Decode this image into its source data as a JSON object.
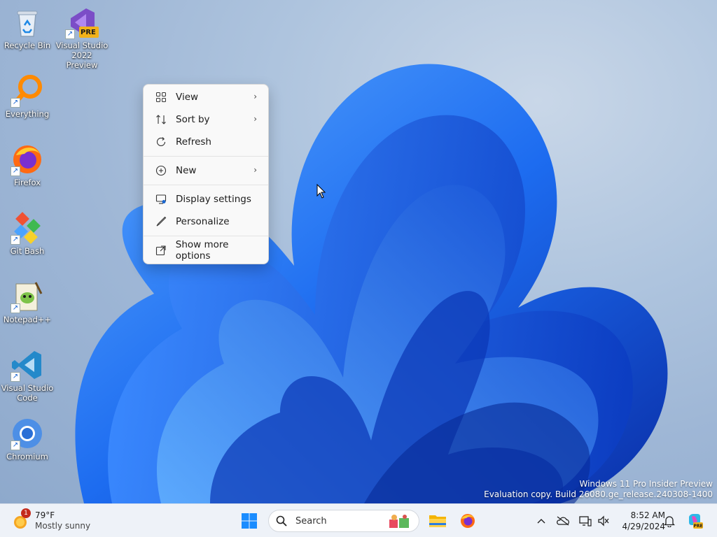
{
  "desktop": {
    "icons": [
      {
        "label": "Recycle Bin",
        "icon": "recycle-bin-icon"
      },
      {
        "label": "Visual Studio 2022 Preview",
        "icon": "visual-studio-preview-icon",
        "badge": "PRE"
      },
      {
        "label": "Everything",
        "icon": "everything-search-icon"
      },
      {
        "label": "Firefox",
        "icon": "firefox-icon"
      },
      {
        "label": "Git Bash",
        "icon": "git-bash-icon"
      },
      {
        "label": "Notepad++",
        "icon": "notepad-plus-plus-icon"
      },
      {
        "label": "Visual Studio Code",
        "icon": "vscode-icon"
      },
      {
        "label": "Chromium",
        "icon": "chromium-icon"
      }
    ]
  },
  "context_menu": {
    "items": [
      {
        "label": "View",
        "icon": "view-grid-icon",
        "has_submenu": true
      },
      {
        "label": "Sort by",
        "icon": "sort-icon",
        "has_submenu": true
      },
      {
        "label": "Refresh",
        "icon": "refresh-icon",
        "has_submenu": false
      },
      {
        "label": "New",
        "icon": "new-plus-icon",
        "has_submenu": true
      },
      {
        "label": "Display settings",
        "icon": "display-settings-icon",
        "has_submenu": false
      },
      {
        "label": "Personalize",
        "icon": "personalize-brush-icon",
        "has_submenu": false
      },
      {
        "label": "Show more options",
        "icon": "show-more-options-icon",
        "has_submenu": false
      }
    ]
  },
  "watermark": {
    "line1": "Windows 11 Pro Insider Preview",
    "line2": "Evaluation copy. Build 26080.ge_release.240308-1400"
  },
  "taskbar": {
    "weather": {
      "temperature": "79°F",
      "condition": "Mostly sunny",
      "badge_count": "1"
    },
    "search": {
      "placeholder": "Search"
    },
    "apps": [
      "start-icon",
      "file-explorer-icon",
      "firefox-icon"
    ],
    "tray": [
      "chevron-up-icon",
      "onedrive-offline-icon",
      "network-icon",
      "speaker-muted-icon"
    ],
    "clock": {
      "time": "8:52 AM",
      "date": "4/29/2024"
    }
  },
  "colors": {
    "accent": "#1a66d0",
    "wallpaper_bloom": "#1e63e6",
    "menu_bg": "#f9f9f9",
    "taskbar_bg": "#eef2f8"
  }
}
